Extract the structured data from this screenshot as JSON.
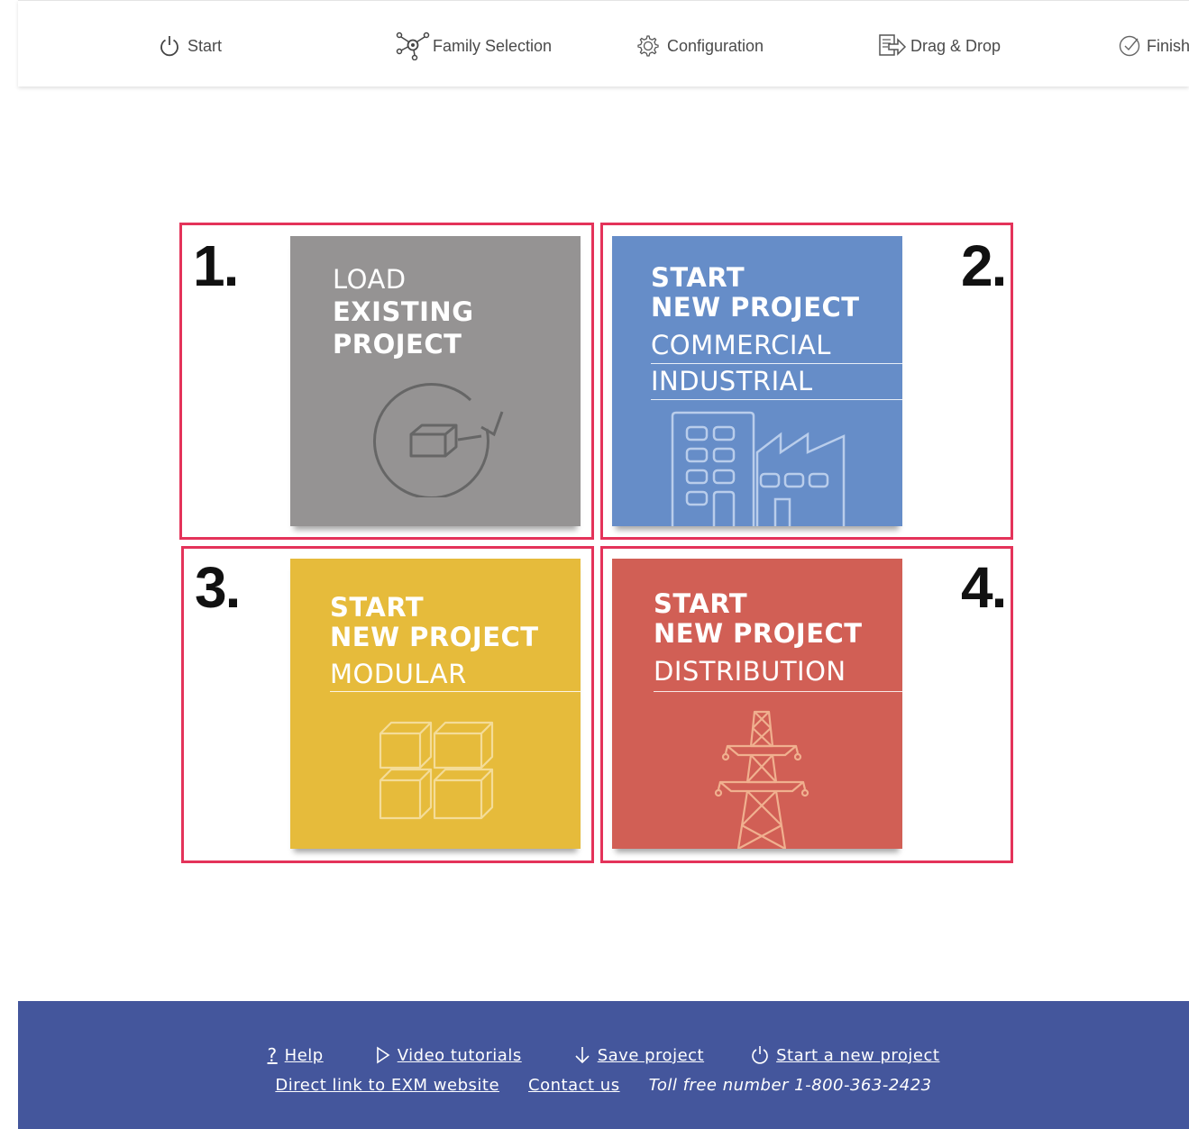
{
  "steps": [
    {
      "label": "Start",
      "icon": "power-icon"
    },
    {
      "label": "Family Selection",
      "icon": "network-icon"
    },
    {
      "label": "Configuration",
      "icon": "gear-icon"
    },
    {
      "label": "Drag & Drop",
      "icon": "drag-drop-icon"
    },
    {
      "label": "Finish",
      "icon": "check-circle-icon"
    }
  ],
  "tiles": [
    {
      "number": "1.",
      "lines": [
        "LOAD",
        "EXISTING",
        "PROJECT"
      ],
      "color": "#959393",
      "icon": "load-project-icon"
    },
    {
      "number": "2.",
      "lines": [
        "START",
        "NEW PROJECT"
      ],
      "subtitles": [
        "COMMERCIAL",
        "INDUSTRIAL"
      ],
      "color": "#668dc8",
      "icon": "building-factory-icon"
    },
    {
      "number": "3.",
      "lines": [
        "START",
        "NEW PROJECT"
      ],
      "subtitles": [
        "MODULAR"
      ],
      "color": "#e6bb3b",
      "icon": "modular-cubes-icon"
    },
    {
      "number": "4.",
      "lines": [
        "START",
        "NEW PROJECT"
      ],
      "subtitles": [
        "DISTRIBUTION"
      ],
      "color": "#d15f55",
      "icon": "power-tower-icon"
    }
  ],
  "highlight_color": "#e4335a",
  "footer": {
    "color": "#44569c",
    "links": [
      {
        "label": "Help",
        "icon": "question-icon"
      },
      {
        "label": "Video tutorials",
        "icon": "play-icon"
      },
      {
        "label": "Save project",
        "icon": "download-arrow-icon"
      },
      {
        "label": "Start a new project",
        "icon": "power-icon"
      }
    ],
    "direct_link": "Direct link to EXM website",
    "contact": "Contact us",
    "toll_free": "Toll free number 1-800-363-2423"
  }
}
